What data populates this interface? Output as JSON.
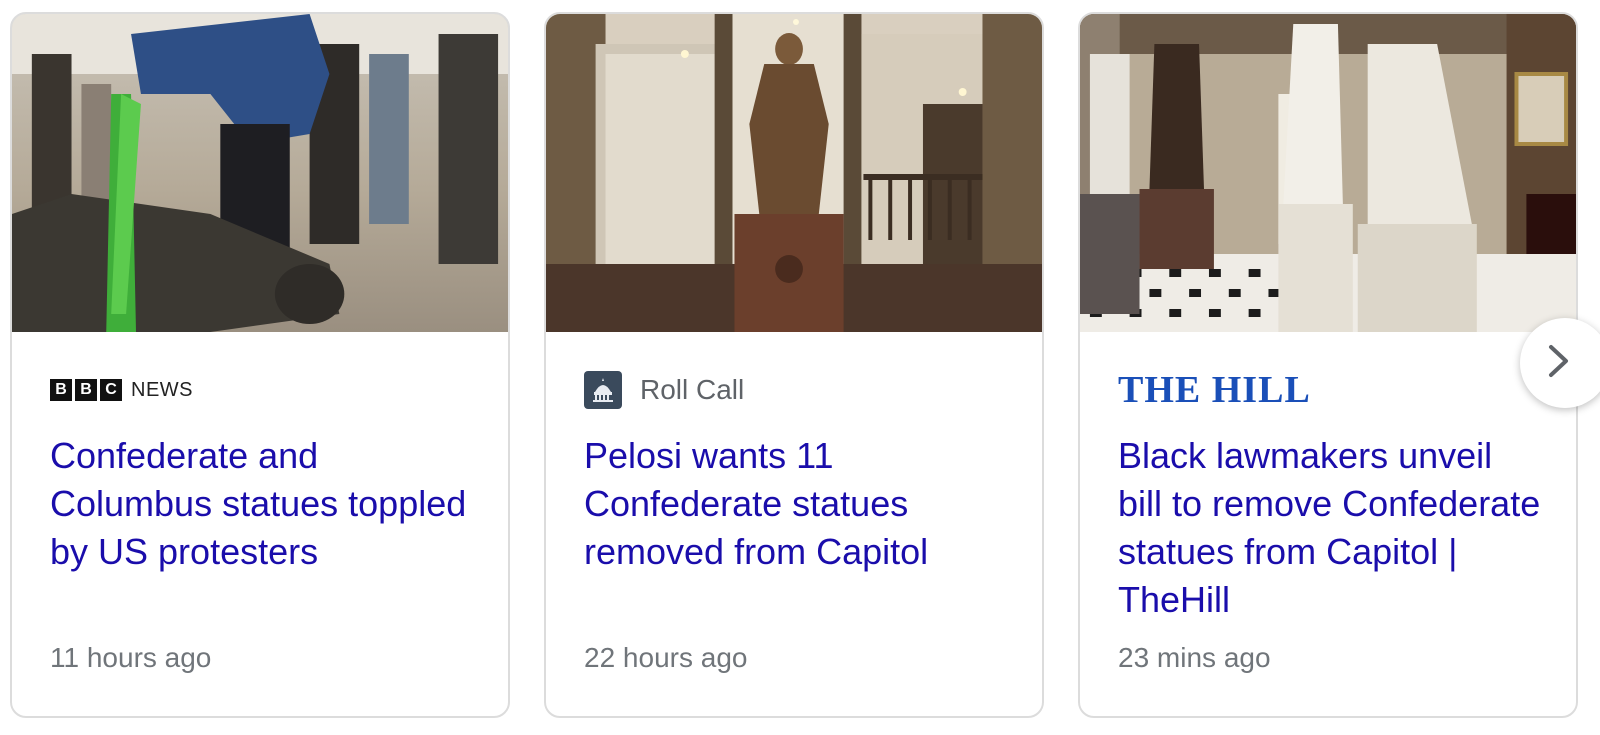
{
  "cards": [
    {
      "source": {
        "logo_text": [
          "B",
          "B",
          "C"
        ],
        "logo_suffix": "NEWS"
      },
      "headline": "Confederate and Columbus statues toppled by US protesters",
      "time": "11 hours ago"
    },
    {
      "source": {
        "name": "Roll Call",
        "icon": "capitol-dome-icon"
      },
      "headline": "Pelosi wants 11 Confederate statues removed from Capitol",
      "time": "22 hours ago"
    },
    {
      "source": {
        "logo_text": "THE HILL"
      },
      "headline": "Black lawmakers unveil bill to remove Confederate statues from Capitol | TheHill",
      "time": "23 mins ago"
    }
  ],
  "next_button": {
    "icon": "chevron-right-icon"
  },
  "colors": {
    "headline": "#1a0dab",
    "meta": "#70757a",
    "hill_brand": "#1a4fb8",
    "card_border": "#dcdcdc"
  }
}
